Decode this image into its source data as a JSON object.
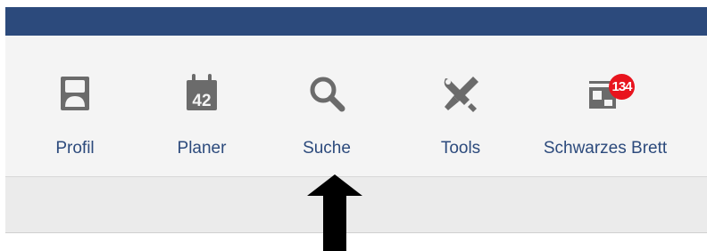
{
  "nav": {
    "items": [
      {
        "label": "Profil",
        "icon": "user-icon"
      },
      {
        "label": "Planer",
        "icon": "calendar-icon",
        "icon_text": "42"
      },
      {
        "label": "Suche",
        "icon": "search-icon"
      },
      {
        "label": "Tools",
        "icon": "tools-icon"
      },
      {
        "label": "Schwarzes Brett",
        "icon": "board-icon",
        "badge": "134"
      }
    ]
  },
  "colors": {
    "top_bar": "#2c4a7c",
    "label": "#2c4a7c",
    "icon": "#6b6b6b",
    "badge": "#e8141e",
    "nav_bg": "#f4f4f4",
    "sub_bar_bg": "#ebebeb",
    "arrow": "#000000"
  }
}
